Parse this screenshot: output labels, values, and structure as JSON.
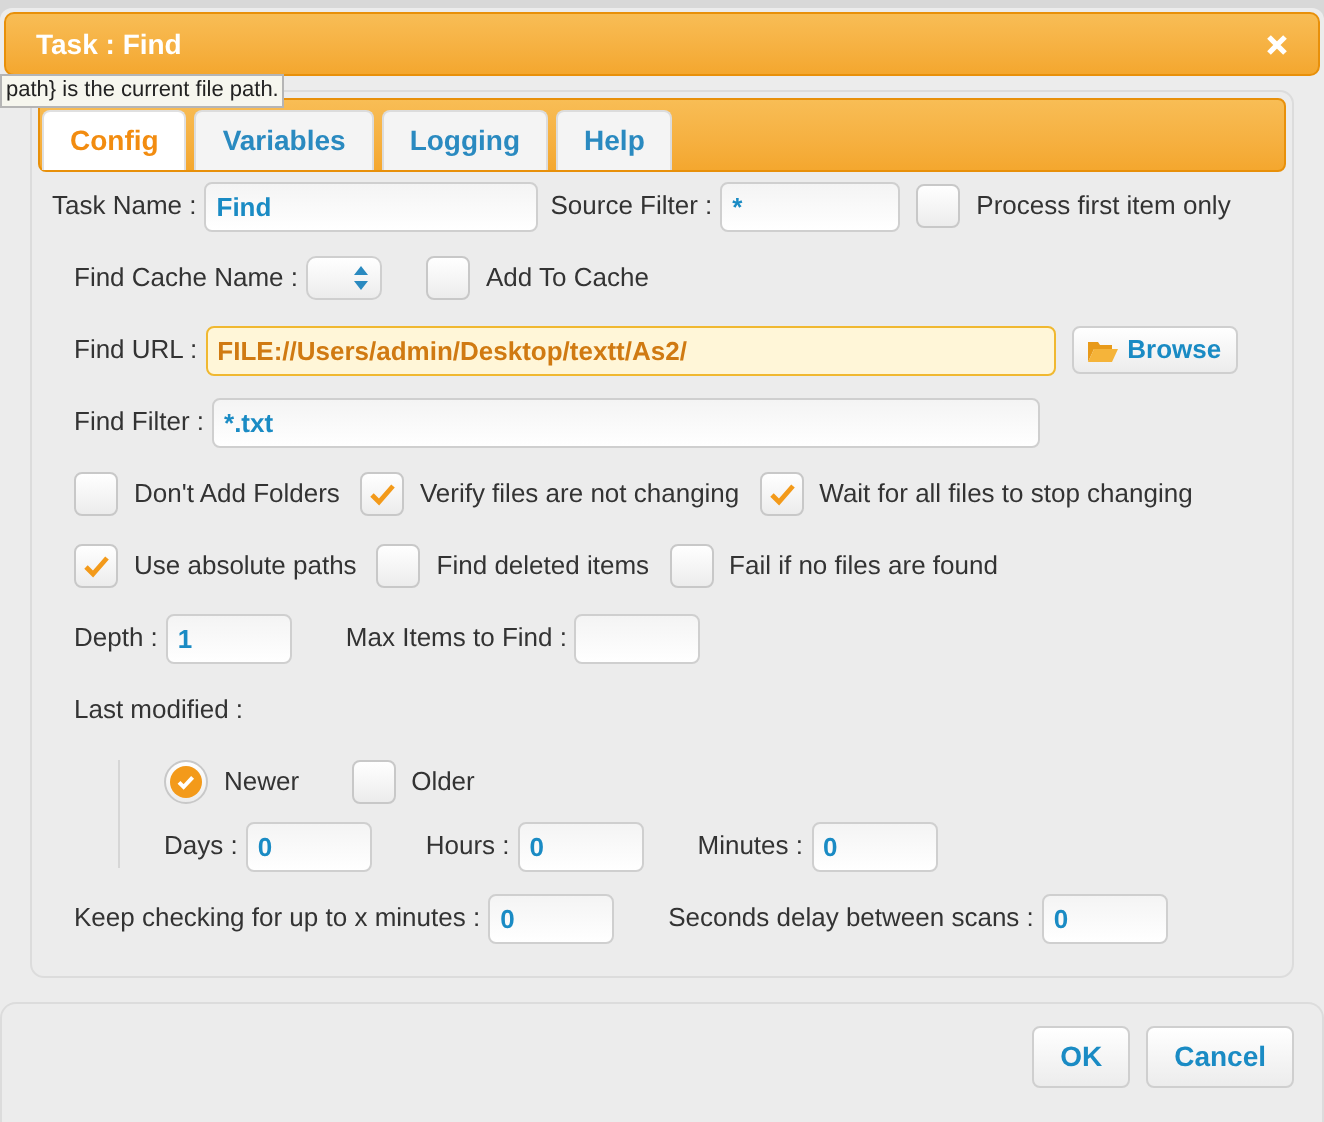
{
  "window": {
    "title": "Task : Find"
  },
  "tooltip": "path} is the current file path.",
  "tabs": [
    {
      "label": "Config",
      "selected": true
    },
    {
      "label": "Variables",
      "selected": false
    },
    {
      "label": "Logging",
      "selected": false
    },
    {
      "label": "Help",
      "selected": false
    }
  ],
  "rows": [
    {
      "kind": "row",
      "items": [
        {
          "kind": "label",
          "text": "Task Name :"
        },
        {
          "kind": "input",
          "value": "Find"
        },
        {
          "kind": "label",
          "text": "Source Filter :"
        },
        {
          "kind": "input",
          "value": "*"
        },
        {
          "kind": "checkbox",
          "label": "Process first item only",
          "checked": false
        }
      ]
    },
    {
      "kind": "row",
      "items": [
        {
          "kind": "label",
          "text": "Find Cache Name :"
        },
        {
          "kind": "select"
        },
        {
          "kind": "checkbox",
          "label": "Add To Cache",
          "checked": false
        }
      ]
    },
    {
      "kind": "row",
      "items": [
        {
          "kind": "label",
          "text": "Find URL :"
        },
        {
          "kind": "input",
          "value": "FILE://Users/admin/Desktop/textt/As2/",
          "focused": true
        },
        {
          "kind": "button",
          "text": "Browse"
        }
      ]
    },
    {
      "kind": "row",
      "items": [
        {
          "kind": "label",
          "text": "Find Filter :"
        },
        {
          "kind": "input",
          "value": "*.txt",
          "focused": false
        }
      ]
    },
    {
      "kind": "row",
      "items": [
        {
          "kind": "checkbox",
          "label": "Don't Add Folders",
          "checked": false
        },
        {
          "kind": "checkbox",
          "label": "Verify files are not changing",
          "checked": true
        },
        {
          "kind": "checkbox",
          "label": "Wait for all files to stop changing",
          "checked": true
        }
      ]
    },
    {
      "kind": "row",
      "items": [
        {
          "kind": "checkbox",
          "label": "Use absolute paths",
          "checked": true
        },
        {
          "kind": "checkbox",
          "label": "Find deleted items",
          "checked": false
        },
        {
          "kind": "checkbox",
          "label": "Fail if no files are found",
          "checked": false
        }
      ]
    },
    {
      "kind": "row",
      "items": [
        {
          "kind": "label",
          "text": "Depth :"
        },
        {
          "kind": "input",
          "value": "1"
        },
        {
          "kind": "label",
          "text": "Max Items to Find :"
        },
        {
          "kind": "input",
          "value": ""
        }
      ]
    },
    {
      "kind": "row",
      "items": [
        {
          "kind": "label",
          "text": "Last modified :"
        }
      ]
    },
    {
      "kind": "group",
      "rows": [
        {
          "kind": "row",
          "items": [
            {
              "kind": "radio",
              "label": "Newer",
              "checked": true
            },
            {
              "kind": "checkbox",
              "label": "Older",
              "checked": false
            }
          ]
        },
        {
          "kind": "row",
          "items": [
            {
              "kind": "label",
              "text": "Days :"
            },
            {
              "kind": "input",
              "value": "0"
            },
            {
              "kind": "label",
              "text": "Hours :"
            },
            {
              "kind": "input",
              "value": "0"
            },
            {
              "kind": "label",
              "text": "Minutes :"
            },
            {
              "kind": "input",
              "value": "0"
            }
          ]
        }
      ]
    },
    {
      "kind": "row",
      "items": [
        {
          "kind": "label",
          "text": "Keep checking for up to x minutes :"
        },
        {
          "kind": "input",
          "value": "0"
        },
        {
          "kind": "label",
          "text": "Seconds delay between scans :"
        },
        {
          "kind": "input",
          "value": "0"
        }
      ]
    }
  ],
  "buttons": [
    "OK",
    "Cancel"
  ]
}
